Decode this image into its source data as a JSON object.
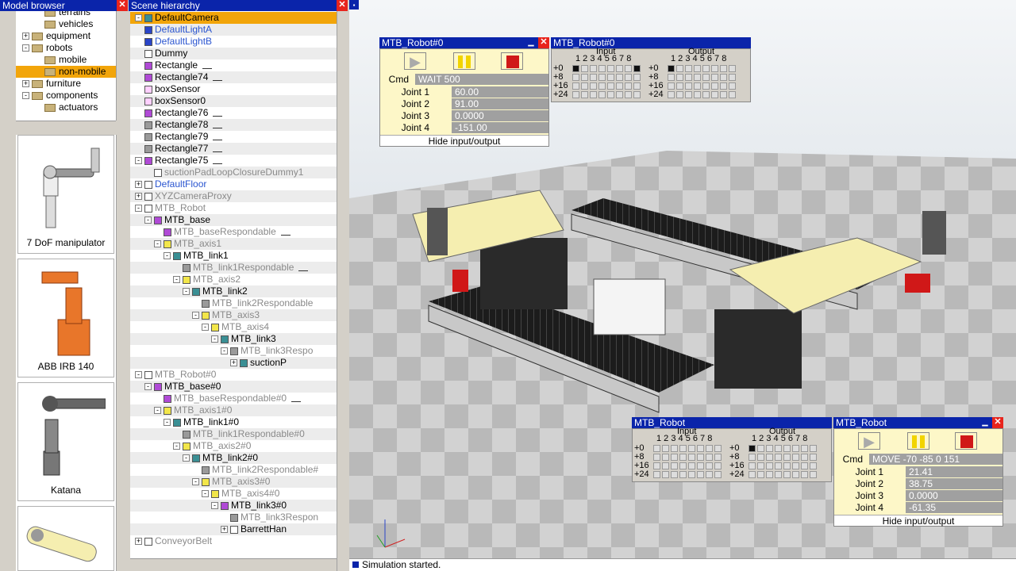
{
  "model_browser": {
    "title": "Model browser",
    "tree": [
      {
        "label": "terrains",
        "indent": 1,
        "toggle": ""
      },
      {
        "label": "vehicles",
        "indent": 1,
        "toggle": ""
      },
      {
        "label": "equipment",
        "indent": 0,
        "toggle": "+"
      },
      {
        "label": "robots",
        "indent": 0,
        "toggle": "-"
      },
      {
        "label": "mobile",
        "indent": 1,
        "toggle": ""
      },
      {
        "label": "non-mobile",
        "indent": 1,
        "toggle": "",
        "selected": true
      },
      {
        "label": "furniture",
        "indent": 0,
        "toggle": "+"
      },
      {
        "label": "components",
        "indent": 0,
        "toggle": "-"
      },
      {
        "label": "actuators",
        "indent": 1,
        "toggle": ""
      }
    ],
    "models": [
      "7 DoF manipulator",
      "ABB IRB 140",
      "Katana",
      ""
    ]
  },
  "scene": {
    "title": "Scene hierarchy",
    "rows": [
      {
        "t": "DefaultCamera",
        "d": 0,
        "icon": "c",
        "pm": "-",
        "style": "hl"
      },
      {
        "t": "DefaultLightA",
        "d": 0,
        "icon": "b",
        "style": "blueT"
      },
      {
        "t": "DefaultLightB",
        "d": 0,
        "icon": "b",
        "style": "blueT"
      },
      {
        "t": "Dummy",
        "d": 0,
        "icon": "l"
      },
      {
        "t": "Rectangle",
        "d": 0,
        "icon": "p",
        "sensor": true
      },
      {
        "t": "Rectangle74",
        "d": 0,
        "icon": "p",
        "sensor": true
      },
      {
        "t": "boxSensor",
        "d": 0,
        "icon": "f"
      },
      {
        "t": "boxSensor0",
        "d": 0,
        "icon": "f"
      },
      {
        "t": "Rectangle76",
        "d": 0,
        "icon": "p",
        "sensor": true
      },
      {
        "t": "Rectangle78",
        "d": 0,
        "icon": "g",
        "sensor": true
      },
      {
        "t": "Rectangle79",
        "d": 0,
        "icon": "g",
        "sensor": true
      },
      {
        "t": "Rectangle77",
        "d": 0,
        "icon": "g",
        "sensor": true
      },
      {
        "t": "Rectangle75",
        "d": 0,
        "icon": "p",
        "pm": "-",
        "sensor": true
      },
      {
        "t": "suctionPadLoopClosureDummy1",
        "d": 1,
        "icon": "l",
        "style": "gray"
      },
      {
        "t": "DefaultFloor",
        "d": 0,
        "icon": "l",
        "pm": "+",
        "style": "blueT"
      },
      {
        "t": "XYZCameraProxy",
        "d": 0,
        "icon": "l",
        "pm": "+",
        "style": "gray"
      },
      {
        "t": "MTB_Robot",
        "d": 0,
        "icon": "l",
        "pm": "-",
        "style": "gray"
      },
      {
        "t": "MTB_base",
        "d": 1,
        "icon": "p",
        "pm": "-"
      },
      {
        "t": "MTB_baseRespondable",
        "d": 2,
        "icon": "p",
        "style": "gray",
        "sensor": true
      },
      {
        "t": "MTB_axis1",
        "d": 2,
        "icon": "y",
        "pm": "-",
        "style": "gray"
      },
      {
        "t": "MTB_link1",
        "d": 3,
        "icon": "c",
        "pm": "-"
      },
      {
        "t": "MTB_link1Respondable",
        "d": 4,
        "icon": "g",
        "style": "gray",
        "sensor": true
      },
      {
        "t": "MTB_axis2",
        "d": 4,
        "icon": "y",
        "pm": "-",
        "style": "gray"
      },
      {
        "t": "MTB_link2",
        "d": 5,
        "icon": "c",
        "pm": "-"
      },
      {
        "t": "MTB_link2Respondable",
        "d": 6,
        "icon": "g",
        "style": "gray"
      },
      {
        "t": "MTB_axis3",
        "d": 6,
        "icon": "y",
        "pm": "-",
        "style": "gray"
      },
      {
        "t": "MTB_axis4",
        "d": 7,
        "icon": "y",
        "pm": "-",
        "style": "gray"
      },
      {
        "t": "MTB_link3",
        "d": 8,
        "icon": "c",
        "pm": "-"
      },
      {
        "t": "MTB_link3Respo",
        "d": 9,
        "icon": "g",
        "pm": "-",
        "style": "gray"
      },
      {
        "t": "suctionP",
        "d": 10,
        "icon": "c",
        "pm": "+"
      },
      {
        "t": "MTB_Robot#0",
        "d": 0,
        "icon": "l",
        "pm": "-",
        "style": "gray"
      },
      {
        "t": "MTB_base#0",
        "d": 1,
        "icon": "p",
        "pm": "-"
      },
      {
        "t": "MTB_baseRespondable#0",
        "d": 2,
        "icon": "p",
        "style": "gray",
        "sensor": true
      },
      {
        "t": "MTB_axis1#0",
        "d": 2,
        "icon": "y",
        "pm": "-",
        "style": "gray"
      },
      {
        "t": "MTB_link1#0",
        "d": 3,
        "icon": "c",
        "pm": "-"
      },
      {
        "t": "MTB_link1Respondable#0",
        "d": 4,
        "icon": "g",
        "style": "gray"
      },
      {
        "t": "MTB_axis2#0",
        "d": 4,
        "icon": "y",
        "pm": "-",
        "style": "gray"
      },
      {
        "t": "MTB_link2#0",
        "d": 5,
        "icon": "c",
        "pm": "-"
      },
      {
        "t": "MTB_link2Respondable#",
        "d": 6,
        "icon": "g",
        "style": "gray"
      },
      {
        "t": "MTB_axis3#0",
        "d": 6,
        "icon": "y",
        "pm": "-",
        "style": "gray"
      },
      {
        "t": "MTB_axis4#0",
        "d": 7,
        "icon": "y",
        "pm": "-",
        "style": "gray"
      },
      {
        "t": "MTB_link3#0",
        "d": 8,
        "icon": "p",
        "pm": "-"
      },
      {
        "t": "MTB_link3Respon",
        "d": 9,
        "icon": "g",
        "style": "gray"
      },
      {
        "t": "BarrettHan",
        "d": 9,
        "icon": "l",
        "pm": "+"
      },
      {
        "t": "ConveyorBelt",
        "d": 0,
        "icon": "l",
        "pm": "+",
        "style": "gray"
      }
    ]
  },
  "panel_top": {
    "title": "MTB_Robot#0",
    "io_title": "MTB_Robot#0",
    "cmd_label": "Cmd",
    "cmd_value": "WAIT 500",
    "joints": [
      {
        "label": "Joint 1",
        "value": "60.00"
      },
      {
        "label": "Joint 2",
        "value": "91.00"
      },
      {
        "label": "Joint 3",
        "value": "0.0000"
      },
      {
        "label": "Joint 4",
        "value": "-151.00"
      }
    ],
    "hide_label": "Hide input/output",
    "input_on": [
      0,
      7
    ],
    "output_on": [
      0
    ]
  },
  "panel_bottom": {
    "title": "MTB_Robot",
    "io_title": "MTB_Robot",
    "cmd_label": "Cmd",
    "cmd_value": "MOVE -70 -85 0 151",
    "joints": [
      {
        "label": "Joint 1",
        "value": "21.41"
      },
      {
        "label": "Joint 2",
        "value": "38.75"
      },
      {
        "label": "Joint 3",
        "value": "0.0000"
      },
      {
        "label": "Joint 4",
        "value": "-61.35"
      }
    ],
    "hide_label": "Hide input/output",
    "input_on": [],
    "output_on": [
      0
    ]
  },
  "io_labels": {
    "input": "Input",
    "output": "Output",
    "bits": "1 2 3 4 5 6 7 8",
    "rows": [
      "+0",
      "+8",
      "+16",
      "+24"
    ]
  },
  "status": "Simulation started.",
  "colors": {
    "title_bar": "#0a24aa",
    "selection": "#f2a50a",
    "panel_bg": "#fdf7c8",
    "close": "#e8241c"
  }
}
